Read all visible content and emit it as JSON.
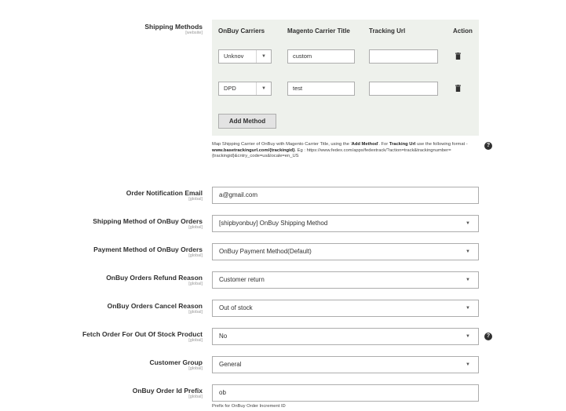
{
  "shipping_methods": {
    "label": "Shipping Methods",
    "scope": "[website]",
    "columns": [
      "OnBuy Carriers",
      "Magento Carrier Title",
      "Tracking Url",
      "Action"
    ],
    "rows": [
      {
        "carrier": "Unknov",
        "title": "custom",
        "tracking_url": ""
      },
      {
        "carrier": "DPD",
        "title": "test",
        "tracking_url": ""
      }
    ],
    "add_button": "Add Method",
    "note_parts": [
      "Map Shipping Carrier of OnBuy with Magento Carrier Title, using the '",
      "Add Method",
      "'. For ",
      "Tracking Url",
      " use the following format - ",
      "www.basetrackingurl.com/{trackingid}",
      ". Eg : https://www.fedex.com/apps/fedextrack/?action=track&trackingnumber={trackingid}&cntry_code=us&locale=en_US"
    ]
  },
  "fields": [
    {
      "label": "Order Notification Email",
      "scope": "[global]",
      "value": "a@gmail.com",
      "type": "input"
    },
    {
      "label": "Shipping Method of OnBuy Orders",
      "scope": "[global]",
      "value": "[shipbyonbuy] OnBuy Shipping Method",
      "type": "select"
    },
    {
      "label": "Payment Method of OnBuy Orders",
      "scope": "[global]",
      "value": "OnBuy Payment Method(Default)",
      "type": "select"
    },
    {
      "label": "OnBuy Orders Refund Reason",
      "scope": "[global]",
      "value": "Customer return",
      "type": "select"
    },
    {
      "label": "OnBuy Orders Cancel Reason",
      "scope": "[global]",
      "value": "Out of stock",
      "type": "select"
    },
    {
      "label": "Fetch Order For Out Of Stock Product",
      "scope": "[global]",
      "value": "No",
      "type": "select"
    },
    {
      "label": "Customer Group",
      "scope": "[global]",
      "value": "General",
      "type": "select"
    },
    {
      "label": "OnBuy Order Id Prefix",
      "scope": "[global]",
      "value": "ob",
      "type": "input"
    }
  ],
  "prefix_hint": "Prefix for OnBuy Order Increment ID",
  "icons": {
    "select_arrow": "▼",
    "help": "?"
  }
}
